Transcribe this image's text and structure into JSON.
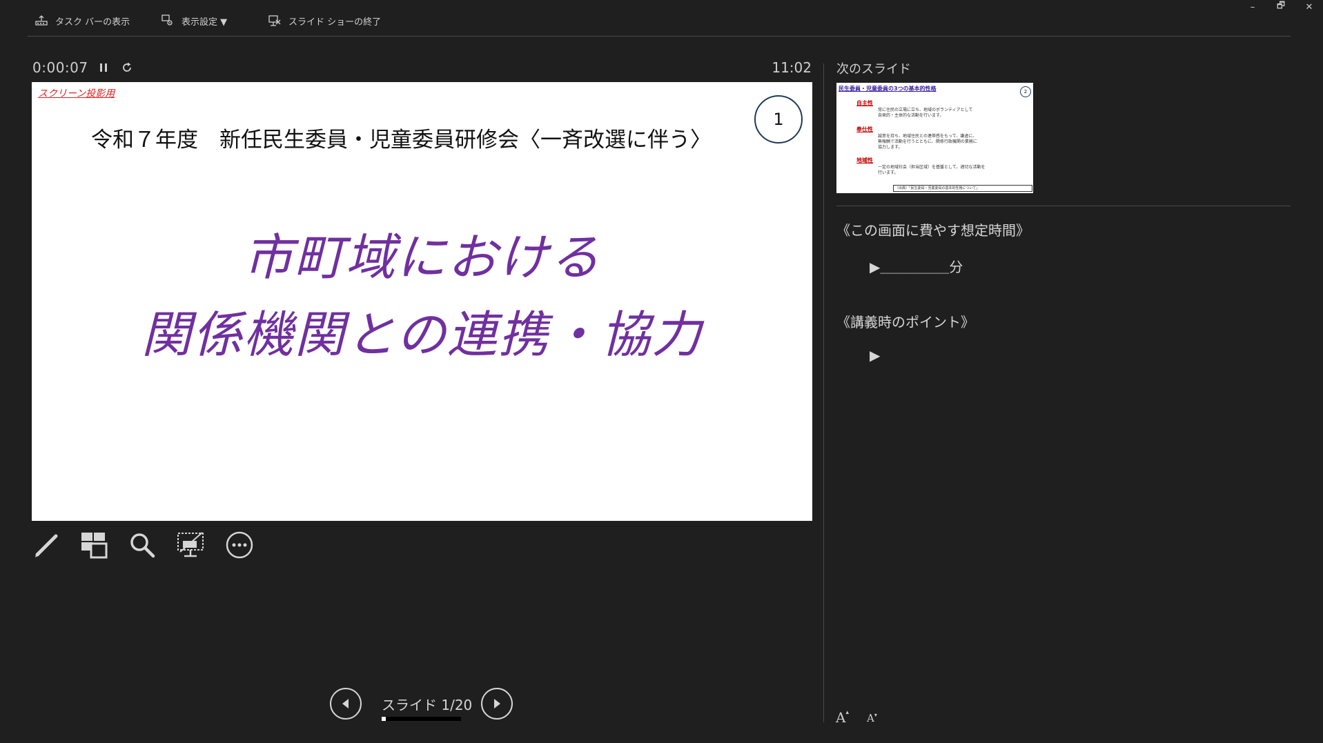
{
  "toolbar": {
    "taskbar_label": "タスク バーの表示",
    "display_settings_label": "表示設定 ▼",
    "end_show_label": "スライド ショーの終了"
  },
  "window": {
    "minimize": "–",
    "restore": "🗗",
    "close": "✕"
  },
  "presenter": {
    "elapsed_time": "0:00:07",
    "clock": "11:02"
  },
  "current_slide": {
    "screen_tag": "スクリーン投影用",
    "number": "1",
    "subtitle": "令和７年度　新任民生委員・児童委員研修会〈一斉改選に伴う〉",
    "title_line1": "市町域における",
    "title_line2": "関係機関との連携・協力"
  },
  "navigation": {
    "slide_label": "スライド 1/20",
    "progress": 0.05
  },
  "next_slide": {
    "label": "次のスライド",
    "title": "民生委員・児童委員の3つの基本的性格",
    "number": "2",
    "items": [
      {
        "heading": "自主性",
        "text1": "常に住民の立場に立ち、地域のボランティアとして",
        "text2": "自発的・主体的な活動を行います。"
      },
      {
        "heading": "奉仕性",
        "text1": "誠意を持ち、地域住民との連帯感をもって、謙虚に、",
        "text2": "無報酬で活動を行うとともに、関係行政機関の業務に"
      },
      {
        "heading": "地域性",
        "text1": "一定の地域社会（担当区域）を基盤として、適切な活動を",
        "text2": "行います。"
      }
    ],
    "extra_line": "協力します。",
    "footer": "（出典）「民生委員・児童委員の基本的性格について」"
  },
  "notes": {
    "time_heading": "《この画面に費やす想定時間》",
    "time_line": "▶＿＿＿＿＿分",
    "points_heading": "《講義時のポイント》",
    "points_line": "▶"
  },
  "font_controls": {
    "increase": "A",
    "decrease": "A"
  }
}
